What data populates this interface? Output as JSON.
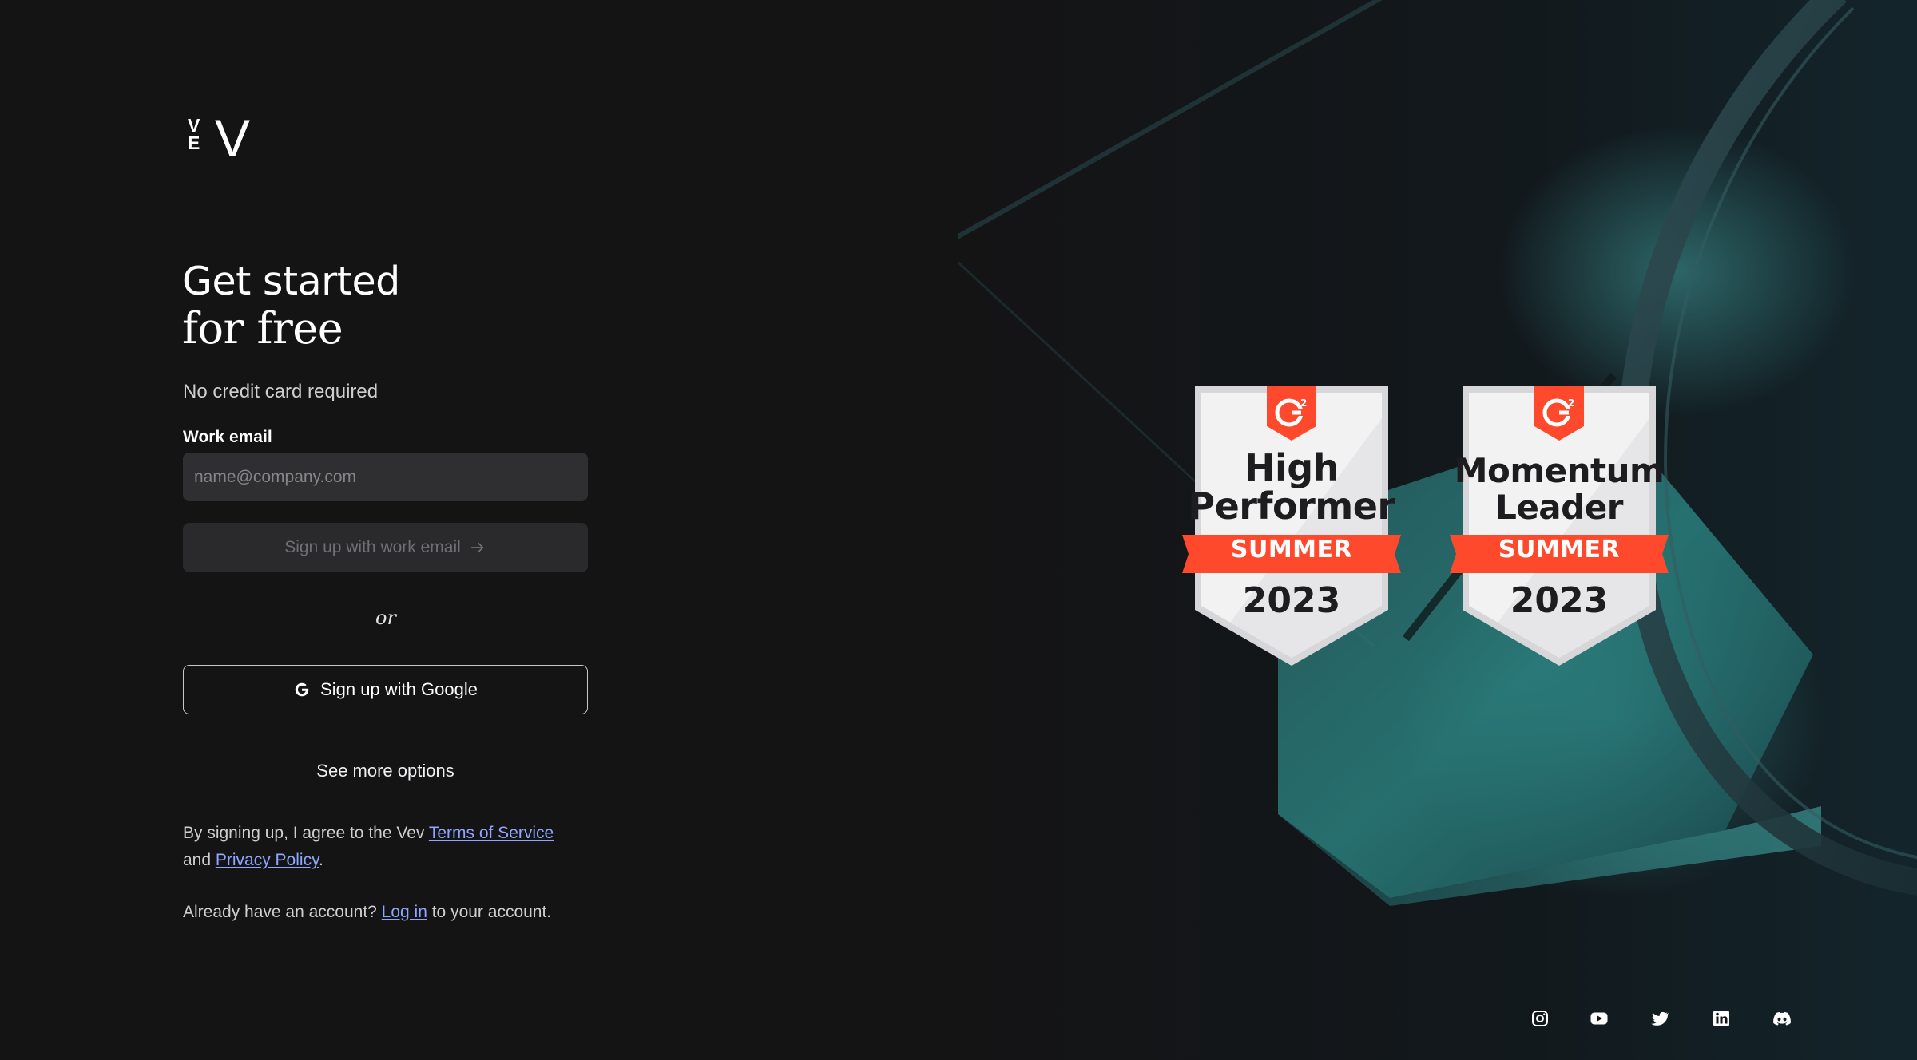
{
  "logo": {
    "small_top": "V",
    "small_bottom": "E",
    "big": "V"
  },
  "heading": {
    "line1": "Get started",
    "line2": "for free"
  },
  "subtitle": "No credit card required",
  "form": {
    "email_label": "Work email",
    "email_placeholder": "name@company.com",
    "email_value": "",
    "submit_label": "Sign up with work email",
    "divider_text": "or",
    "google_label": "Sign up with Google",
    "more_options": "See more options"
  },
  "legal": {
    "prefix": "By signing up, I agree to the Vev ",
    "terms_link": "Terms of Service",
    "and": "and ",
    "privacy_link": "Privacy Policy",
    "suffix": "."
  },
  "account": {
    "prefix": "Already have an account? ",
    "login_link": "Log in",
    "suffix": " to your account."
  },
  "badges": [
    {
      "logo": "G2",
      "title_line1": "High",
      "title_line2": "Performer",
      "season": "SUMMER",
      "year": "2023"
    },
    {
      "logo": "G2",
      "title_line1": "Momentum",
      "title_line2": "Leader",
      "season": "SUMMER",
      "year": "2023"
    }
  ],
  "social_icons": [
    "instagram-icon",
    "youtube-icon",
    "twitter-icon",
    "linkedin-icon",
    "discord-icon"
  ],
  "colors": {
    "background": "#141415",
    "accent_link": "#8ea6ff",
    "badge_red": "#ff492c",
    "teal": "#3a9a9a"
  }
}
